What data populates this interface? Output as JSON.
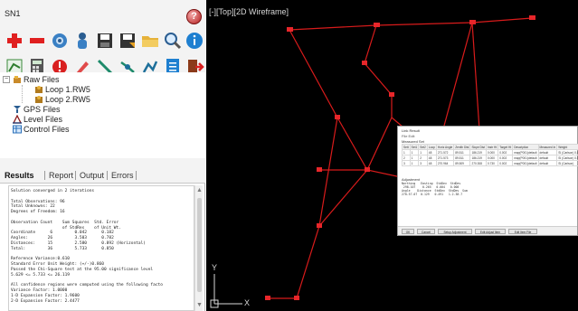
{
  "app": {
    "title": "SN1",
    "help_label": "?"
  },
  "toolbar1": {
    "icons": [
      "add-icon",
      "remove-icon",
      "settings-icon",
      "person-icon",
      "save-icon",
      "save-as-icon",
      "open-folder-icon",
      "zoom-icon",
      "info-icon"
    ]
  },
  "toolbar2": {
    "icons": [
      "adjust-icon",
      "calculator-icon",
      "stop-icon",
      "edit-icon",
      "line-icon",
      "survey-icon",
      "draw-icon",
      "document-icon",
      "exit-icon"
    ]
  },
  "tree": {
    "raw_files": "Raw Files",
    "loops": [
      "Loop 1.RW5",
      "Loop 2.RW5"
    ],
    "gps_files": "GPS Files",
    "level_files": "Level Files",
    "control_files": "Control Files"
  },
  "tabs": [
    "Results",
    "Report",
    "Output",
    "Errors"
  ],
  "results_lines": [
    "Solution converged in 2 iterations",
    "",
    "Total Observations: 96",
    "Total Unknowns: 22",
    "Degrees of Freedom: 16",
    "",
    "Observation Count    Sum Squares  Std. Error",
    "                     of StdRes    of Unit Wt.",
    "Coordinate      6         0.042      0.182",
    "Angles:        26         3.503      0.782",
    "Distances:     15         2.580      0.892 (Horizontal)",
    "Total:         36         5.733      0.850",
    "",
    "Reference Variance:0.610",
    "Standard Error Unit Weight: (+/-)0.860",
    "Passed the Chi-Square test at the 95.00 significance level",
    "5.629 <= 5.733 <= 26.119",
    "",
    "All confidence regions were computed using the following facto",
    "Variance Factor: 1.0000",
    "1-D Expansion Factor: 1.9600",
    "2-D Expansion Factor: 2.4477"
  ],
  "viewport": {
    "label": "[-][Top][2D Wireframe]",
    "axis_x": "X",
    "axis_y": "Y"
  },
  "dialog": {
    "title": "Link Result",
    "menu": "File  Edit",
    "section1": "Measured Set",
    "headers": [
      "Sett",
      "Set1",
      "Set2",
      "Loop",
      "Horiz Angle",
      "Zenith Dist",
      "Slope Dist",
      "Instr Ht",
      "Target Ht",
      "Description",
      "Measured In",
      "Weight",
      "Fix",
      "Use"
    ],
    "rows": [
      [
        "1",
        "1",
        "1",
        "48",
        "271.572",
        "89.511",
        "186.219",
        "0.000",
        "0.002",
        "map(P001)default",
        "default",
        "SI (Carlson) 0.51",
        ""
      ],
      [
        "2",
        "1",
        "2",
        "48",
        "271.573",
        "89.511",
        "186.219",
        "0.000",
        "0.002",
        "map(P001)default",
        "default",
        "SI (Carlson) 0.51",
        ""
      ],
      [
        "3",
        "1",
        "3",
        "48",
        "270.964",
        "89.509",
        "270.308",
        "0.730",
        "0.002",
        "map(P001)default",
        "default",
        "SI (Carlson)",
        ""
      ]
    ],
    "section2": "Adjustment",
    "summary": "Northing   Easting  StdDev  StdDev\n 298.107    0.265   0.004   0.008\nAngle    Distance  StdDev  StdDev  Sum\n270.57.07  0.129   0.491   1.2.38.7",
    "buttons": [
      "OK",
      "Cancel",
      "Setup Adjustment",
      "Edit Adjust Item",
      "Edit Item File"
    ]
  },
  "colors": {
    "accent": "#0a6fc2",
    "traverse": "#d81b1b",
    "viewport_bg": "#000000"
  }
}
